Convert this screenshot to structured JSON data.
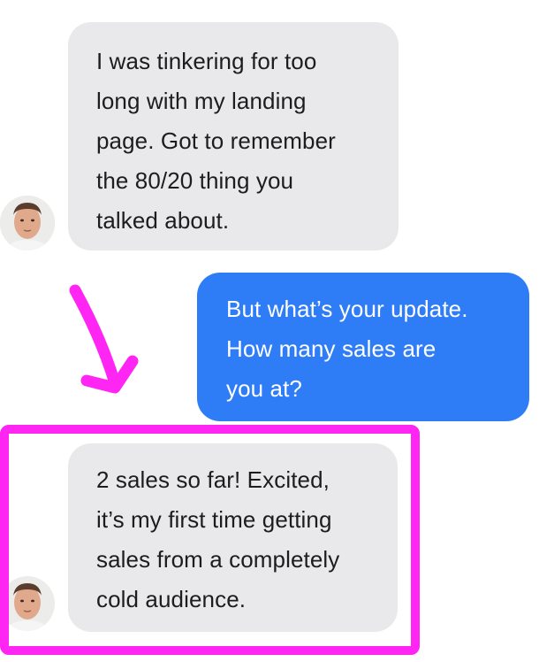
{
  "conversation": {
    "messages": [
      {
        "sender": "contact",
        "lines": [
          "I was tinkering for too",
          "long with my landing",
          "page. Got to remember",
          "the 80/20 thing you",
          "talked about."
        ]
      },
      {
        "sender": "me",
        "lines": [
          "But what’s your update.",
          "How many sales are",
          "you at?"
        ]
      },
      {
        "sender": "contact",
        "lines": [
          "2 sales so far! Excited,",
          "it’s my first time getting",
          "sales from a completely",
          "cold audience."
        ]
      }
    ]
  },
  "colors": {
    "incoming_bubble": "#e9e9eb",
    "outgoing_bubble": "#2f7df6",
    "highlight_annotation": "#ff26f4"
  },
  "annotations": {
    "arrow_icon": "arrow-down-right-icon",
    "highlight": "highlight-box"
  }
}
